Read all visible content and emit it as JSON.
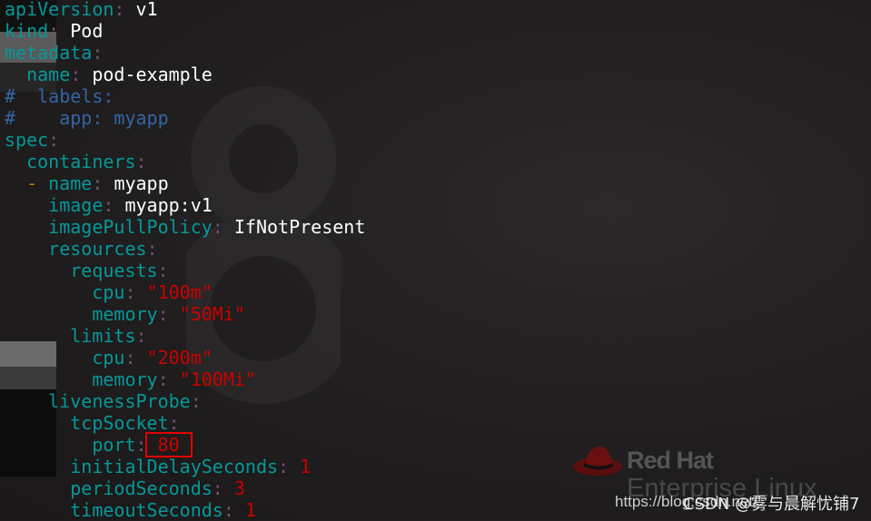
{
  "colors": {
    "key": "#06989a",
    "punct": "#75507b",
    "value": "#ffffff",
    "string": "#cc0000",
    "comment": "#3465a4",
    "highlight_box": "#e00000"
  },
  "lines": [
    [
      {
        "t": "apiVersion",
        "c": "k"
      },
      {
        "t": ": ",
        "c": "p"
      },
      {
        "t": "v1",
        "c": "v"
      }
    ],
    [
      {
        "t": "kind",
        "c": "k"
      },
      {
        "t": ": ",
        "c": "p"
      },
      {
        "t": "Pod",
        "c": "v"
      }
    ],
    [
      {
        "t": "metadata",
        "c": "k"
      },
      {
        "t": ":",
        "c": "p"
      }
    ],
    [
      {
        "t": "  name",
        "c": "k"
      },
      {
        "t": ": ",
        "c": "p"
      },
      {
        "t": "pod-example",
        "c": "v"
      }
    ],
    [
      {
        "t": "#  labels:",
        "c": "c"
      }
    ],
    [
      {
        "t": "#    app: myapp",
        "c": "c"
      }
    ],
    [
      {
        "t": "spec",
        "c": "k"
      },
      {
        "t": ":",
        "c": "p"
      }
    ],
    [
      {
        "t": "  containers",
        "c": "k"
      },
      {
        "t": ":",
        "c": "p"
      }
    ],
    [
      {
        "t": "  - ",
        "c": "d"
      },
      {
        "t": "name",
        "c": "k"
      },
      {
        "t": ": ",
        "c": "p"
      },
      {
        "t": "myapp",
        "c": "v"
      }
    ],
    [
      {
        "t": "    image",
        "c": "k"
      },
      {
        "t": ": ",
        "c": "p"
      },
      {
        "t": "myapp:v1",
        "c": "v"
      }
    ],
    [
      {
        "t": "    imagePullPolicy",
        "c": "k"
      },
      {
        "t": ": ",
        "c": "p"
      },
      {
        "t": "IfNotPresent",
        "c": "v"
      }
    ],
    [
      {
        "t": "    resources",
        "c": "k"
      },
      {
        "t": ":",
        "c": "p"
      }
    ],
    [
      {
        "t": "      requests",
        "c": "k"
      },
      {
        "t": ":",
        "c": "p"
      }
    ],
    [
      {
        "t": "        cpu",
        "c": "k"
      },
      {
        "t": ": ",
        "c": "p"
      },
      {
        "t": "\"100m\"",
        "c": "s"
      }
    ],
    [
      {
        "t": "        memory",
        "c": "k"
      },
      {
        "t": ": ",
        "c": "p"
      },
      {
        "t": "\"50Mi\"",
        "c": "s"
      }
    ],
    [
      {
        "t": "      limits",
        "c": "k"
      },
      {
        "t": ":",
        "c": "p"
      }
    ],
    [
      {
        "t": "        cpu",
        "c": "k"
      },
      {
        "t": ": ",
        "c": "p"
      },
      {
        "t": "\"200m\"",
        "c": "s"
      }
    ],
    [
      {
        "t": "        memory",
        "c": "k"
      },
      {
        "t": ": ",
        "c": "p"
      },
      {
        "t": "\"100Mi\"",
        "c": "s"
      }
    ],
    [
      {
        "t": "    livenessProbe",
        "c": "k"
      },
      {
        "t": ":",
        "c": "p"
      }
    ],
    [
      {
        "t": "      tcpSocket",
        "c": "k"
      },
      {
        "t": ":",
        "c": "p"
      }
    ],
    [
      {
        "t": "        port",
        "c": "k"
      },
      {
        "t": ":",
        "c": "p"
      },
      {
        "t": " 80 ",
        "c": "s",
        "box": true
      }
    ],
    [
      {
        "t": "      initialDelaySeconds",
        "c": "k"
      },
      {
        "t": ": ",
        "c": "p"
      },
      {
        "t": "1",
        "c": "s"
      }
    ],
    [
      {
        "t": "      periodSeconds",
        "c": "k"
      },
      {
        "t": ": ",
        "c": "p"
      },
      {
        "t": "3",
        "c": "s"
      }
    ],
    [
      {
        "t": "      timeoutSeconds",
        "c": "k"
      },
      {
        "t": ": ",
        "c": "p"
      },
      {
        "t": "1",
        "c": "s"
      }
    ]
  ],
  "brand": {
    "title": "Red Hat",
    "subtitle": "Enterprise Linux"
  },
  "watermark": {
    "url": "https://blog.csdn.net/",
    "author": "CSDN @雾与晨解忧铺7"
  }
}
